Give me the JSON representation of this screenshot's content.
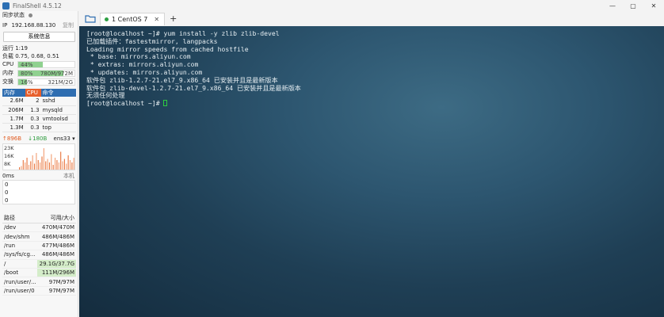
{
  "window": {
    "title": "FinalShell 4.5.12",
    "controls": {
      "minimize": "—",
      "maximize": "▢",
      "close": "✕"
    }
  },
  "sidebar": {
    "sync_label": "同步状态",
    "ip_label": "IP",
    "ip": "192.168.88.130",
    "copy_label": "复制",
    "sysinfo_button": "系统信息",
    "uptime": "运行 1:19",
    "load": "负载 0.75, 0.68, 0.51",
    "cpu": {
      "label": "CPU",
      "percent_text": "44%",
      "fraction": 0.44
    },
    "mem": {
      "label": "内存",
      "percent_text": "80%",
      "used": "780M/972M",
      "fraction": 0.8
    },
    "swap": {
      "label": "交换",
      "percent_text": "16%",
      "used": "321M/2G",
      "fraction": 0.16
    },
    "process_table": {
      "headers": [
        "内存",
        "CPU",
        "命令"
      ],
      "rows": [
        {
          "mem": "2.6M",
          "cpu": "2",
          "cmd": "sshd"
        },
        {
          "mem": "206M",
          "cpu": "1.3",
          "cmd": "mysqld"
        },
        {
          "mem": "1.7M",
          "cpu": "0.3",
          "cmd": "vmtoolsd"
        },
        {
          "mem": "1.3M",
          "cpu": "0.3",
          "cmd": "top"
        }
      ]
    },
    "network": {
      "up": "↑896B",
      "down": "↓180B",
      "interface": "ens33",
      "y_labels": [
        "23K",
        "16K",
        "8K"
      ],
      "activity": [
        0.1,
        0.15,
        0.4,
        0.3,
        0.5,
        0.2,
        0.35,
        0.6,
        0.25,
        0.7,
        0.4,
        0.3,
        0.55,
        0.9,
        0.35,
        0.45,
        0.3,
        0.65,
        0.2,
        0.5,
        0.4,
        0.3,
        0.75,
        0.35,
        0.45,
        0.25,
        0.6,
        0.4,
        0.3,
        0.5
      ]
    },
    "latency": {
      "label": "0ms",
      "right_label": "本机",
      "values": [
        "0",
        "0",
        "0"
      ]
    },
    "disk_table": {
      "headers": [
        "路径",
        "可用/大小"
      ],
      "rows": [
        {
          "path": "/dev",
          "size": "470M/470M",
          "highlight": false
        },
        {
          "path": "/dev/shm",
          "size": "486M/486M",
          "highlight": false
        },
        {
          "path": "/run",
          "size": "477M/486M",
          "highlight": false
        },
        {
          "path": "/sys/fs/cg...",
          "size": "486M/486M",
          "highlight": false
        },
        {
          "path": "/",
          "size": "29.1G/37.7G",
          "highlight": true
        },
        {
          "path": "/boot",
          "size": "111M/296M",
          "highlight": true
        },
        {
          "path": "/run/user/...",
          "size": "97M/97M",
          "highlight": false
        },
        {
          "path": "/run/user/0",
          "size": "97M/97M",
          "highlight": false
        }
      ]
    }
  },
  "tabs": [
    {
      "label": "1 CentOS 7",
      "close": "✕"
    }
  ],
  "add_tab_label": "+",
  "terminal": {
    "lines": [
      "[root@localhost ~]# yum install -y zlib zlib-devel",
      "已加载插件：fastestmirror, langpacks",
      "Loading mirror speeds from cached hostfile",
      " * base: mirrors.aliyun.com",
      " * extras: mirrors.aliyun.com",
      " * updates: mirrors.aliyun.com",
      "软件包 zlib-1.2.7-21.el7_9.x86_64 已安装并且是最新版本",
      "软件包 zlib-devel-1.2.7-21.el7_9.x86_64 已安装并且是最新版本",
      "无须任何处理"
    ],
    "prompt": "[root@localhost ~]# "
  },
  "colors": {
    "accent": "#2f6eb1",
    "cpu_header": "#e8602c",
    "meter_fill": "#8fd18f",
    "cursor": "#2ecc40"
  }
}
